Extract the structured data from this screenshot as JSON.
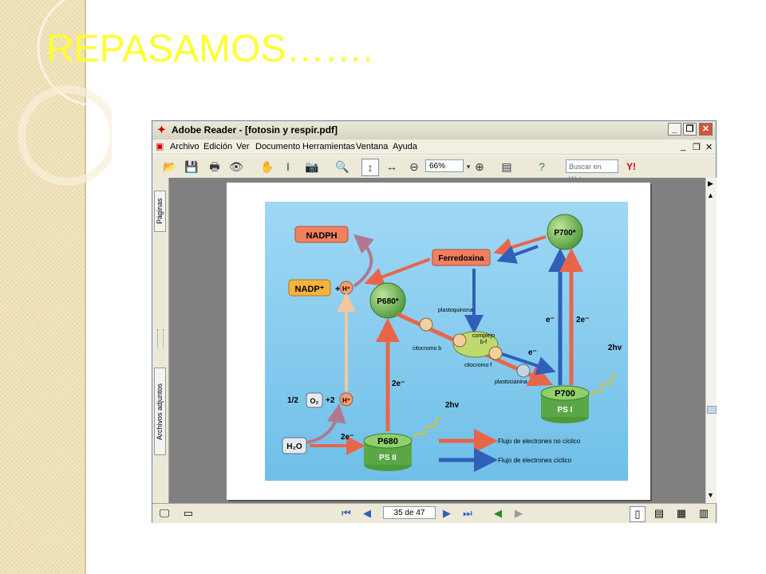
{
  "slide": {
    "title": "REPASAMOS……."
  },
  "window": {
    "title": "Adobe Reader - [fotosin y respir.pdf]",
    "controls": [
      "_",
      "❐",
      "✕"
    ],
    "doc_controls": [
      "_",
      "❐",
      "✕"
    ]
  },
  "menu": [
    "Archivo",
    "Edición",
    "Ver",
    "Documento",
    "Herramientas",
    "Ventana",
    "Ayuda"
  ],
  "toolbar": {
    "zoom": "66%",
    "search_placeholder": "Buscar en Web",
    "yahoo": "Y!"
  },
  "side_tabs": {
    "pages": "Páginas",
    "attachments": "Archivos adjuntos"
  },
  "status": {
    "page_field": "35 de 47"
  },
  "diagram": {
    "nadph": "NADPH",
    "nadp": "NADP⁺",
    "plus1": "+",
    "hplus": "H⁺",
    "ferredoxina": "Ferredoxina",
    "p700star": "P700*",
    "p680star": "P680*",
    "plastoquinona": "plastoquinona",
    "complejo": "complejo",
    "bf": "b-f",
    "citocromo_b": "citocromo b",
    "citocromo_f": "citocromo f",
    "plastocianina": "plastocianina",
    "e_minus": "e⁻",
    "two_e_minus": "2e⁻",
    "two_hv": "2hv",
    "p700": "P700",
    "ps1": "PS I",
    "p680": "P680",
    "ps2": "PS II",
    "half": "1/2",
    "o2": "O₂",
    "plus2": "+2",
    "h2o": "H₂O",
    "legend_noncyclic": "Flujo de electrones no cíclico",
    "legend_cyclic": "Flujo de electrones cíclico",
    "colors": {
      "red": "#e8654a",
      "blue": "#2f5fb8",
      "green": "#5aa845",
      "orange": "#f0a040",
      "sky": "#7cc6ec"
    }
  }
}
